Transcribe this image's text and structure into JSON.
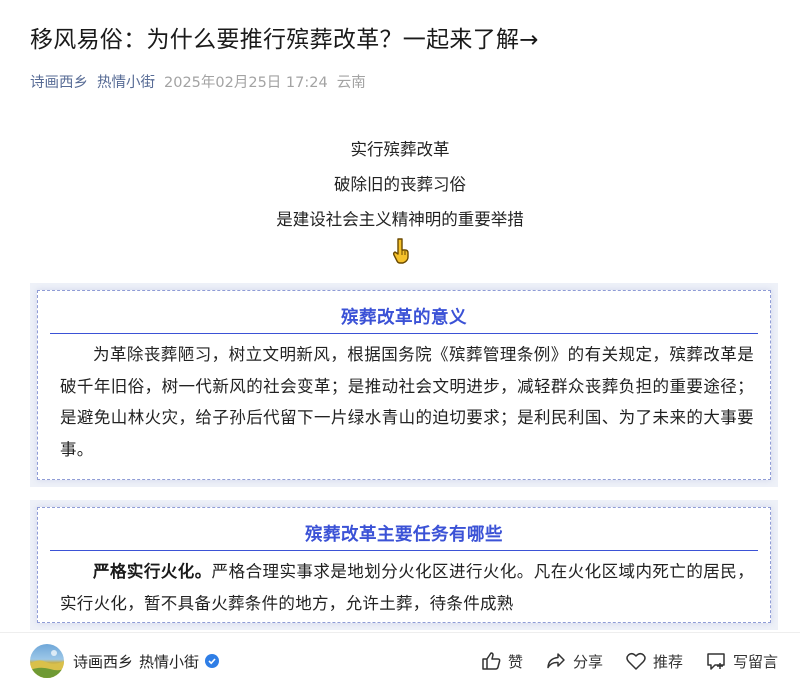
{
  "article": {
    "title": "移风易俗：为什么要推行殡葬改革？一起来了解→",
    "account": "诗画西乡",
    "author": "热情小街",
    "date": "2025年02月25日 17:24",
    "location": "云南"
  },
  "intro": {
    "lines": [
      "实行殡葬改革",
      "破除旧的丧葬习俗",
      "是建设社会主义精神明的重要举措"
    ],
    "pointer_icon": "pointing-down-hand-icon"
  },
  "sections": [
    {
      "heading": "殡葬改革的意义",
      "body": "为革除丧葬陋习，树立文明新风，根据国务院《殡葬管理条例》的有关规定，殡葬改革是破千年旧俗，树一代新风的社会变革；是推动社会文明进步，减轻群众丧葬负担的重要途径；是避免山林火灾，给子孙后代留下一片绿水青山的迫切要求；是利民利国、为了未来的大事要事。"
    },
    {
      "heading": "殡葬改革主要任务有哪些",
      "lead": "严格实行火化。",
      "body": "严格合理实事求是地划分火化区进行火化。凡在火化区域内死亡的居民，实行火化，暂不具备火葬条件的地方，允许土葬，待条件成熟"
    }
  ],
  "bottom_bar": {
    "account": "诗画西乡",
    "author": "热情小街",
    "like_label": "赞",
    "share_label": "分享",
    "recommend_label": "推荐",
    "comment_label": "写留言"
  },
  "colors": {
    "accent_blue": "#3b52d6",
    "link_blue": "#576b95",
    "section_bg": "#eef1f8",
    "verified_blue": "#2f7ee6"
  }
}
